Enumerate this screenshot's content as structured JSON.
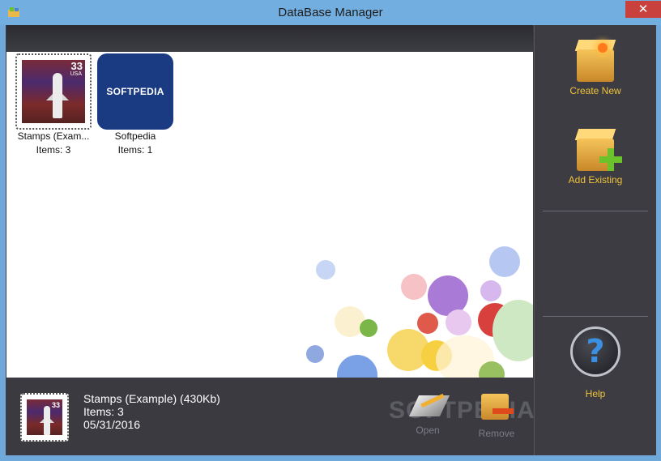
{
  "window": {
    "title": "DataBase Manager",
    "close_glyph": "✕"
  },
  "databases": [
    {
      "name": "Stamps (Exam...",
      "items": "Items: 3",
      "thumb": "stamp-thumbnail"
    },
    {
      "name": "Softpedia",
      "items": "Items: 1",
      "thumb": "softpedia-logo",
      "logo_text": "SOFTPEDIA"
    }
  ],
  "stamp": {
    "denomination": "33",
    "country": "USA"
  },
  "sidebar": {
    "create_new": "Create New",
    "add_existing": "Add Existing",
    "help": "Help",
    "help_glyph": "?"
  },
  "details": {
    "title": "Stamps (Example) (430Kb)",
    "items": "Items: 3",
    "date": "05/31/2016"
  },
  "actions": {
    "open": "Open",
    "remove": "Remove"
  },
  "watermark": "SOFTPEDIA",
  "colors": {
    "titlebar": "#73aee0",
    "panel": "#3c3c42",
    "accent_label": "#f0c43a",
    "close": "#c9413c"
  }
}
